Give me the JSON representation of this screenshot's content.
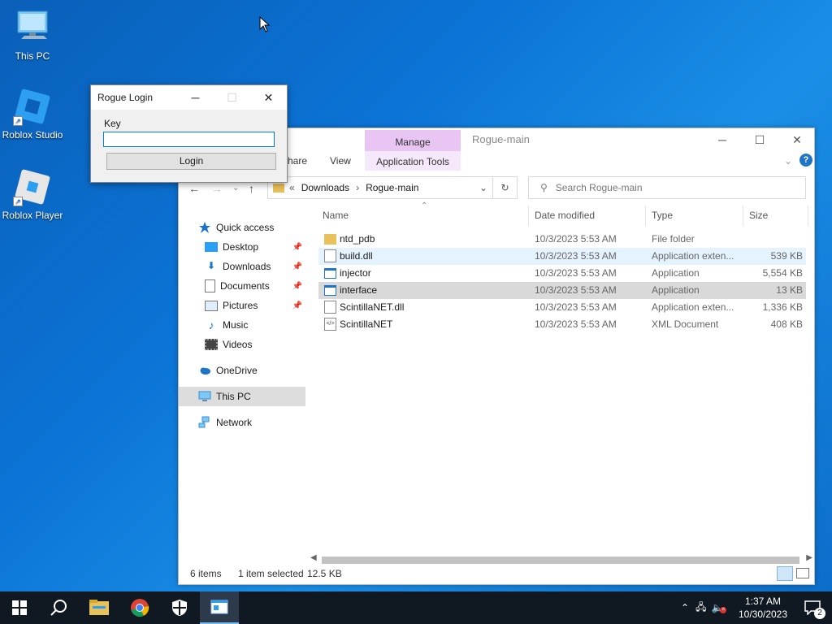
{
  "desktop": {
    "icons": [
      {
        "label": "This PC"
      },
      {
        "label": "Roblox Studio"
      },
      {
        "label": "Roblox Player"
      }
    ]
  },
  "dialog": {
    "title": "Rogue Login",
    "key_label": "Key",
    "key_value": "",
    "login_label": "Login",
    "minimize": "─",
    "maximize": "☐",
    "close": "✕"
  },
  "explorer": {
    "context_tab_header": "Manage",
    "context_tab_sub": "Application Tools",
    "window_title": "Rogue-main",
    "ribbon_tabs": [
      "hare",
      "View"
    ],
    "breadcrumb": [
      "Downloads",
      "Rogue-main"
    ],
    "breadcrumb_prefix": "«",
    "search_placeholder": "Search Rogue-main",
    "columns": [
      "Name",
      "Date modified",
      "Type",
      "Size"
    ],
    "nav": {
      "quick_access": "Quick access",
      "desktop": "Desktop",
      "downloads": "Downloads",
      "documents": "Documents",
      "pictures": "Pictures",
      "music": "Music",
      "videos": "Videos",
      "onedrive": "OneDrive",
      "this_pc": "This PC",
      "network": "Network"
    },
    "files": [
      {
        "name": "ntd_pdb",
        "date": "10/3/2023 5:53 AM",
        "type": "File folder",
        "size": ""
      },
      {
        "name": "build.dll",
        "date": "10/3/2023 5:53 AM",
        "type": "Application exten...",
        "size": "539 KB"
      },
      {
        "name": "injector",
        "date": "10/3/2023 5:53 AM",
        "type": "Application",
        "size": "5,554 KB"
      },
      {
        "name": "interface",
        "date": "10/3/2023 5:53 AM",
        "type": "Application",
        "size": "13 KB"
      },
      {
        "name": "ScintillaNET.dll",
        "date": "10/3/2023 5:53 AM",
        "type": "Application exten...",
        "size": "1,336 KB"
      },
      {
        "name": "ScintillaNET",
        "date": "10/3/2023 5:53 AM",
        "type": "XML Document",
        "size": "408 KB"
      }
    ],
    "status": {
      "items": "6 items",
      "selected": "1 item selected",
      "selected_size": "12.5 KB"
    }
  },
  "taskbar": {
    "time": "1:37 AM",
    "date": "10/30/2023",
    "notification_count": "2"
  }
}
